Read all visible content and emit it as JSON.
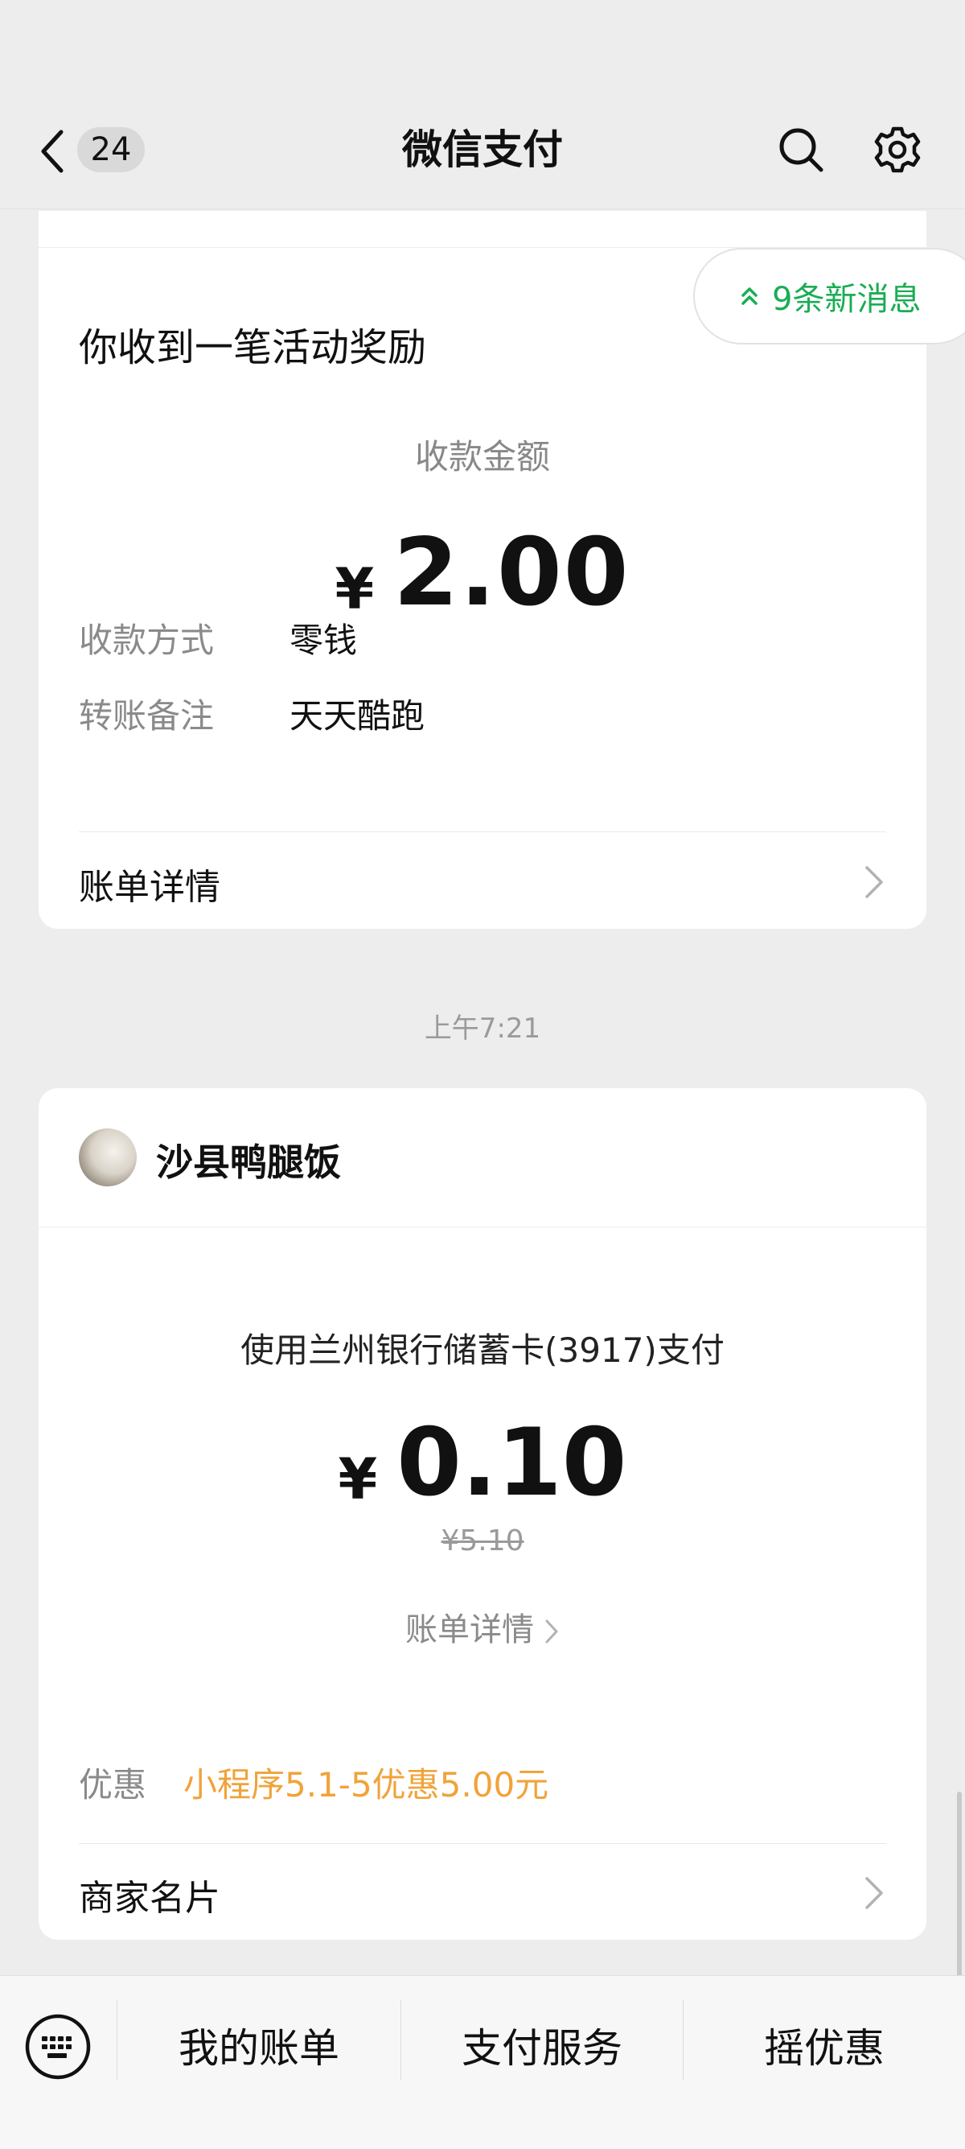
{
  "header": {
    "title": "微信支付",
    "unread_count": "24"
  },
  "new_messages": {
    "label": "9条新消息"
  },
  "card1": {
    "title": "你收到一笔活动奖励",
    "amount_label": "收款金额",
    "currency": "¥",
    "amount": "2.00",
    "rows": [
      {
        "key": "收款方式",
        "value": "零钱"
      },
      {
        "key": "转账备注",
        "value": "天天酷跑"
      }
    ],
    "detail_label": "账单详情"
  },
  "timestamp": "上午7:21",
  "card2": {
    "merchant_name": "沙县鸭腿饭",
    "pay_method": "使用兰州银行储蓄卡(3917)支付",
    "currency": "¥",
    "amount": "0.10",
    "original_price": "¥5.10",
    "detail_label": "账单详情",
    "promo_key": "优惠",
    "promo_value": "小程序5.1-5优惠5.00元",
    "merchant_card_label": "商家名片"
  },
  "bottom_bar": {
    "items": [
      "我的账单",
      "支付服务",
      "摇优惠"
    ]
  },
  "colors": {
    "accent_green": "#1aad54",
    "promo_orange": "#f0a33a",
    "background": "#ededed"
  },
  "icons": {
    "back": "back-chevron-icon",
    "search": "search-icon",
    "settings": "gear-icon",
    "keyboard": "keyboard-icon",
    "double_up": "double-chevron-up-icon"
  }
}
